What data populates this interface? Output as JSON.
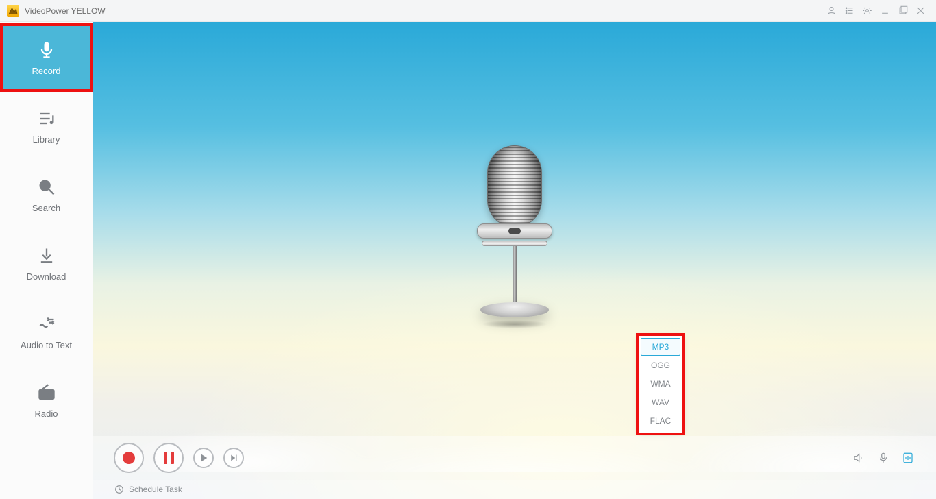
{
  "titlebar": {
    "title": "VideoPower YELLOW"
  },
  "sidebar": {
    "items": [
      {
        "label": "Record",
        "active": true
      },
      {
        "label": "Library",
        "active": false
      },
      {
        "label": "Search",
        "active": false
      },
      {
        "label": "Download",
        "active": false
      },
      {
        "label": "Audio to Text",
        "active": false
      },
      {
        "label": "Radio",
        "active": false
      }
    ]
  },
  "formats": {
    "options": [
      "MP3",
      "OGG",
      "WMA",
      "WAV",
      "FLAC"
    ],
    "selected": "MP3"
  },
  "footer": {
    "schedule_label": "Schedule Task"
  },
  "colors": {
    "accent": "#2aa9d8",
    "highlight": "#e11",
    "record": "#e43c3c"
  }
}
